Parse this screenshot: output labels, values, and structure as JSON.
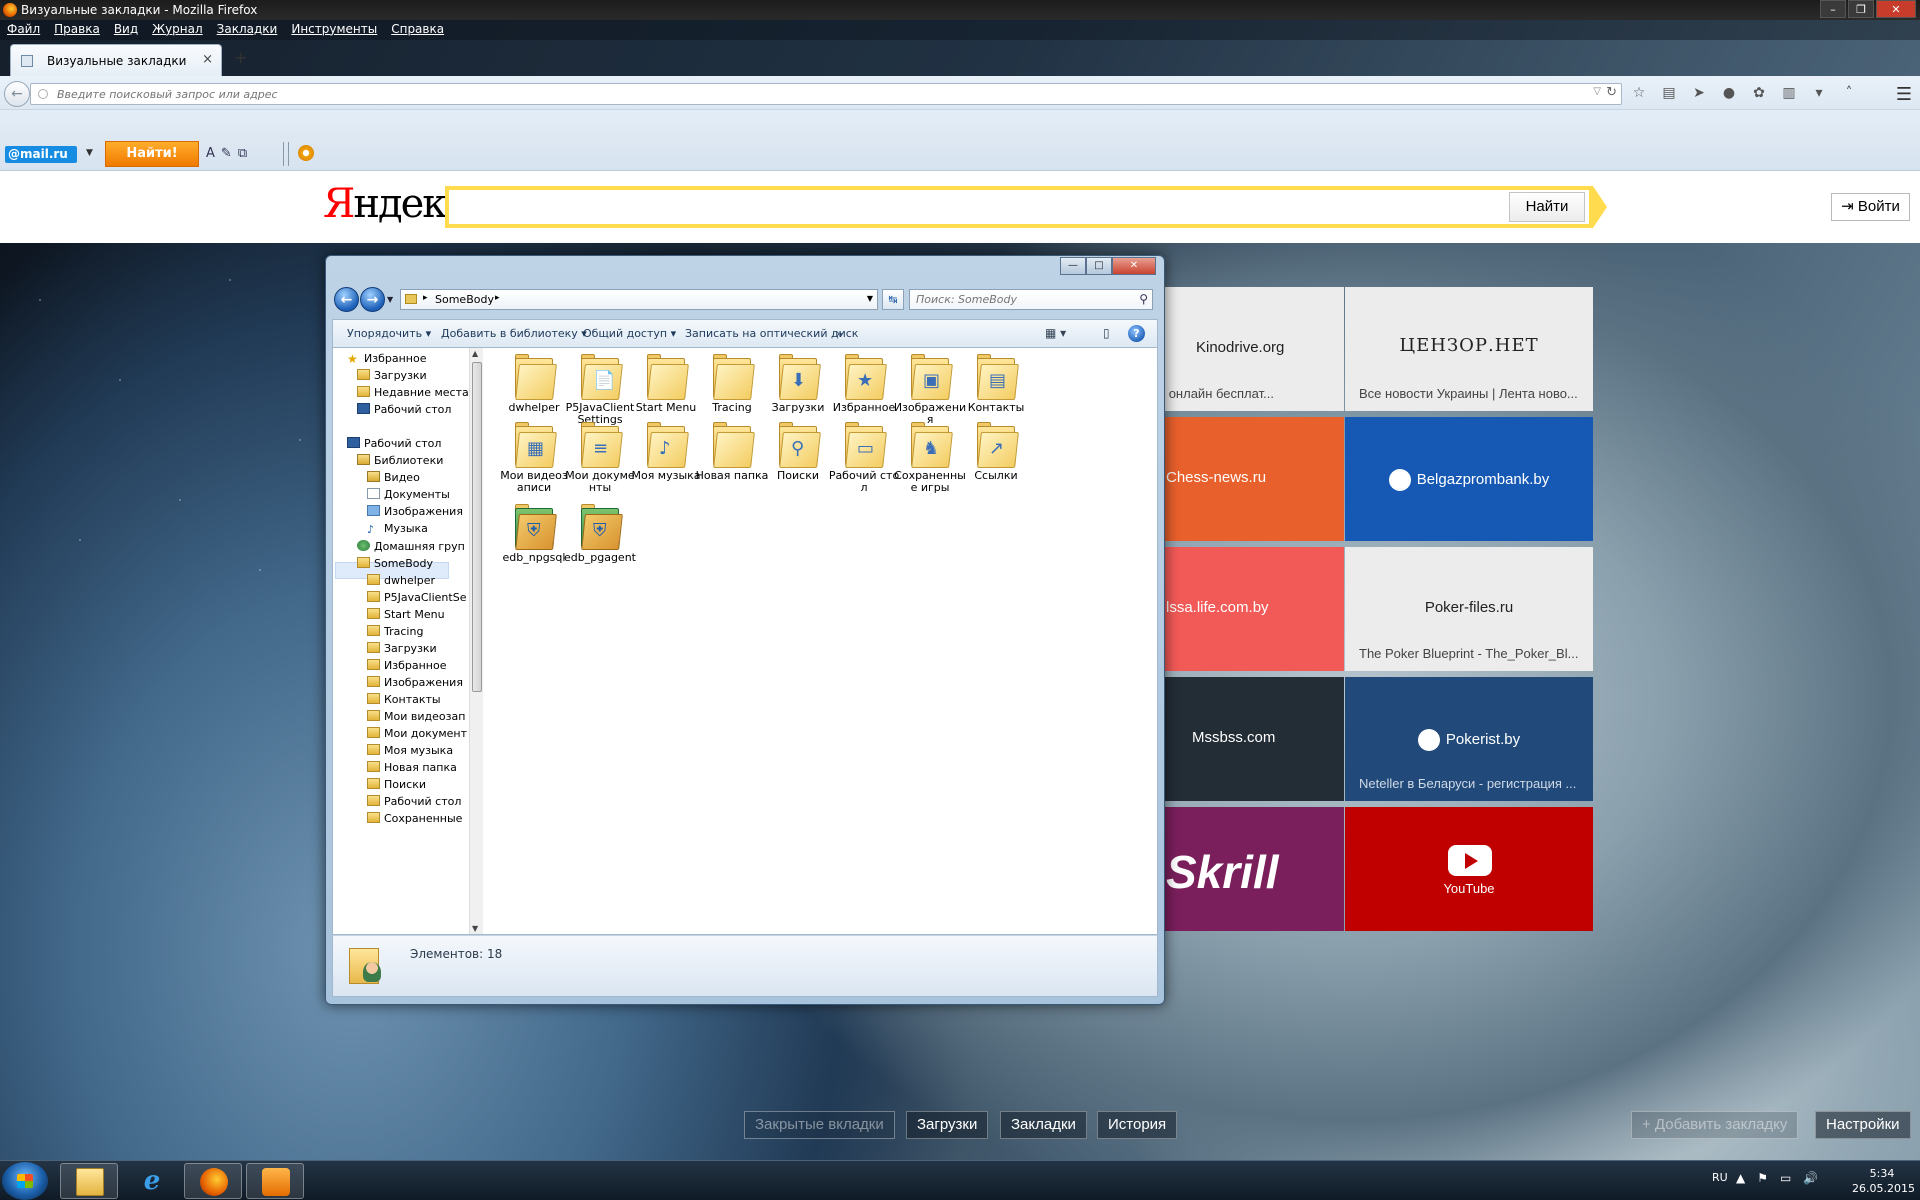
{
  "window": {
    "title": "Визуальные закладки - Mozilla Firefox",
    "controls": [
      "–",
      "❐",
      "✕"
    ]
  },
  "menu": [
    "Файл",
    "Правка",
    "Вид",
    "Журнал",
    "Закладки",
    "Инструменты",
    "Справка"
  ],
  "tab": {
    "label": "Визуальные закладки",
    "close": "×",
    "new": "+"
  },
  "urlbar": {
    "placeholder": "Введите поисковый запрос или адрес",
    "value": ""
  },
  "mailru_bar": {
    "logo": "@mail.ru",
    "find_button": "Найти!"
  },
  "yandex": {
    "logo_first": "Я",
    "logo_rest": "ндекс",
    "search_value": "",
    "search_button": "Найти",
    "login_button": "Войти"
  },
  "tiles": [
    {
      "name": "Kinodrive.org",
      "desc": "смотреть онлайн бесплат...",
      "bg": "#ececec",
      "fg": "#222222"
    },
    {
      "name": "ЦЕНЗОР.НЕТ",
      "desc": "Все новости Украины | Лента ново...",
      "bg": "#ececec",
      "fg": "#222222"
    },
    {
      "name": "Chess-news.ru",
      "desc": "",
      "bg": "#e8602c",
      "fg": "#ffffff"
    },
    {
      "name": "Belgazprombank.by",
      "desc": "",
      "bg": "#1659b4",
      "fg": "#ffffff"
    },
    {
      "name": "lssa.life.com.by",
      "desc": "",
      "bg": "#f25a57",
      "fg": "#ffffff"
    },
    {
      "name": "Poker-files.ru",
      "desc": "The Poker Blueprint - The_Poker_Bl...",
      "bg": "#ececec",
      "fg": "#222222"
    },
    {
      "name": "Mssbss.com",
      "desc": "",
      "bg": "#232d36",
      "fg": "#ffffff"
    },
    {
      "name": "Pokerist.by",
      "desc": "Neteller в Беларуси - регистрация ...",
      "bg": "#214a7a",
      "fg": "#ffffff"
    },
    {
      "name": "Skrill",
      "desc": "",
      "bg": "#7b1f5c",
      "fg": "#ffffff"
    },
    {
      "name": "YouTube",
      "desc": "",
      "bg": "#c00000",
      "fg": "#ffffff"
    }
  ],
  "explorer": {
    "path": "SomeBody",
    "search_placeholder": "Поиск: SomeBody",
    "commands": [
      "Упорядочить",
      "Добавить в библиотеку",
      "Общий доступ",
      "Записать на оптический диск",
      "»"
    ],
    "nav": [
      {
        "label": "Избранное",
        "icon": "star"
      },
      {
        "label": "Загрузки",
        "icon": "fold"
      },
      {
        "label": "Недавние места",
        "icon": "fold"
      },
      {
        "label": "Рабочий стол",
        "icon": "desk"
      },
      {
        "label": "Рабочий стол",
        "icon": "desk"
      },
      {
        "label": "Библиотеки",
        "icon": "lib"
      },
      {
        "label": "Видео",
        "icon": "lib"
      },
      {
        "label": "Документы",
        "icon": "doc"
      },
      {
        "label": "Изображения",
        "icon": "img"
      },
      {
        "label": "Музыка",
        "icon": "music"
      },
      {
        "label": "Домашняя груп",
        "icon": "home"
      },
      {
        "label": "SomeBody",
        "icon": "user"
      },
      {
        "label": "dwhelper",
        "icon": "fold"
      },
      {
        "label": "P5JavaClientSe",
        "icon": "fold"
      },
      {
        "label": "Start Menu",
        "icon": "fold"
      },
      {
        "label": "Tracing",
        "icon": "fold"
      },
      {
        "label": "Загрузки",
        "icon": "fold"
      },
      {
        "label": "Избранное",
        "icon": "fold"
      },
      {
        "label": "Изображения",
        "icon": "fold"
      },
      {
        "label": "Контакты",
        "icon": "fold"
      },
      {
        "label": "Мои видеозап",
        "icon": "fold"
      },
      {
        "label": "Мои документ",
        "icon": "fold"
      },
      {
        "label": "Моя музыка",
        "icon": "fold"
      },
      {
        "label": "Новая папка",
        "icon": "fold"
      },
      {
        "label": "Поиски",
        "icon": "fold"
      },
      {
        "label": "Рабочий стол",
        "icon": "fold"
      },
      {
        "label": "Сохраненные",
        "icon": "fold"
      }
    ],
    "files": [
      {
        "name": "dwhelper",
        "sym": ""
      },
      {
        "name": "P5JavaClientSettings",
        "sym": "📄"
      },
      {
        "name": "Start Menu",
        "sym": ""
      },
      {
        "name": "Tracing",
        "sym": ""
      },
      {
        "name": "Загрузки",
        "sym": "⬇"
      },
      {
        "name": "Избранное",
        "sym": "★"
      },
      {
        "name": "Изображения",
        "sym": "▣"
      },
      {
        "name": "Контакты",
        "sym": "▤"
      },
      {
        "name": "Мои видеозаписи",
        "sym": "▦"
      },
      {
        "name": "Мои документы",
        "sym": "≡"
      },
      {
        "name": "Моя музыка",
        "sym": "♪"
      },
      {
        "name": "Новая папка",
        "sym": ""
      },
      {
        "name": "Поиски",
        "sym": "⚲"
      },
      {
        "name": "Рабочий стол",
        "sym": "▭"
      },
      {
        "name": "Сохраненные игры",
        "sym": "♞"
      },
      {
        "name": "Ссылки",
        "sym": "↗"
      },
      {
        "name": "edb_npgsql",
        "sym": "⛨"
      },
      {
        "name": "edb_pgagent",
        "sym": "⛨"
      }
    ],
    "status": "Элементов: 18"
  },
  "bottom_buttons": [
    {
      "label": "Закрытые вкладки",
      "disabled": true
    },
    {
      "label": "Загрузки",
      "disabled": false
    },
    {
      "label": "Закладки",
      "disabled": false
    },
    {
      "label": "История",
      "disabled": false
    },
    {
      "label": "+ Добавить закладку",
      "disabled": true
    },
    {
      "label": "Настройки",
      "disabled": false
    }
  ],
  "taskbar": {
    "lang": "RU",
    "time": "5:34",
    "date": "26.05.2015"
  }
}
